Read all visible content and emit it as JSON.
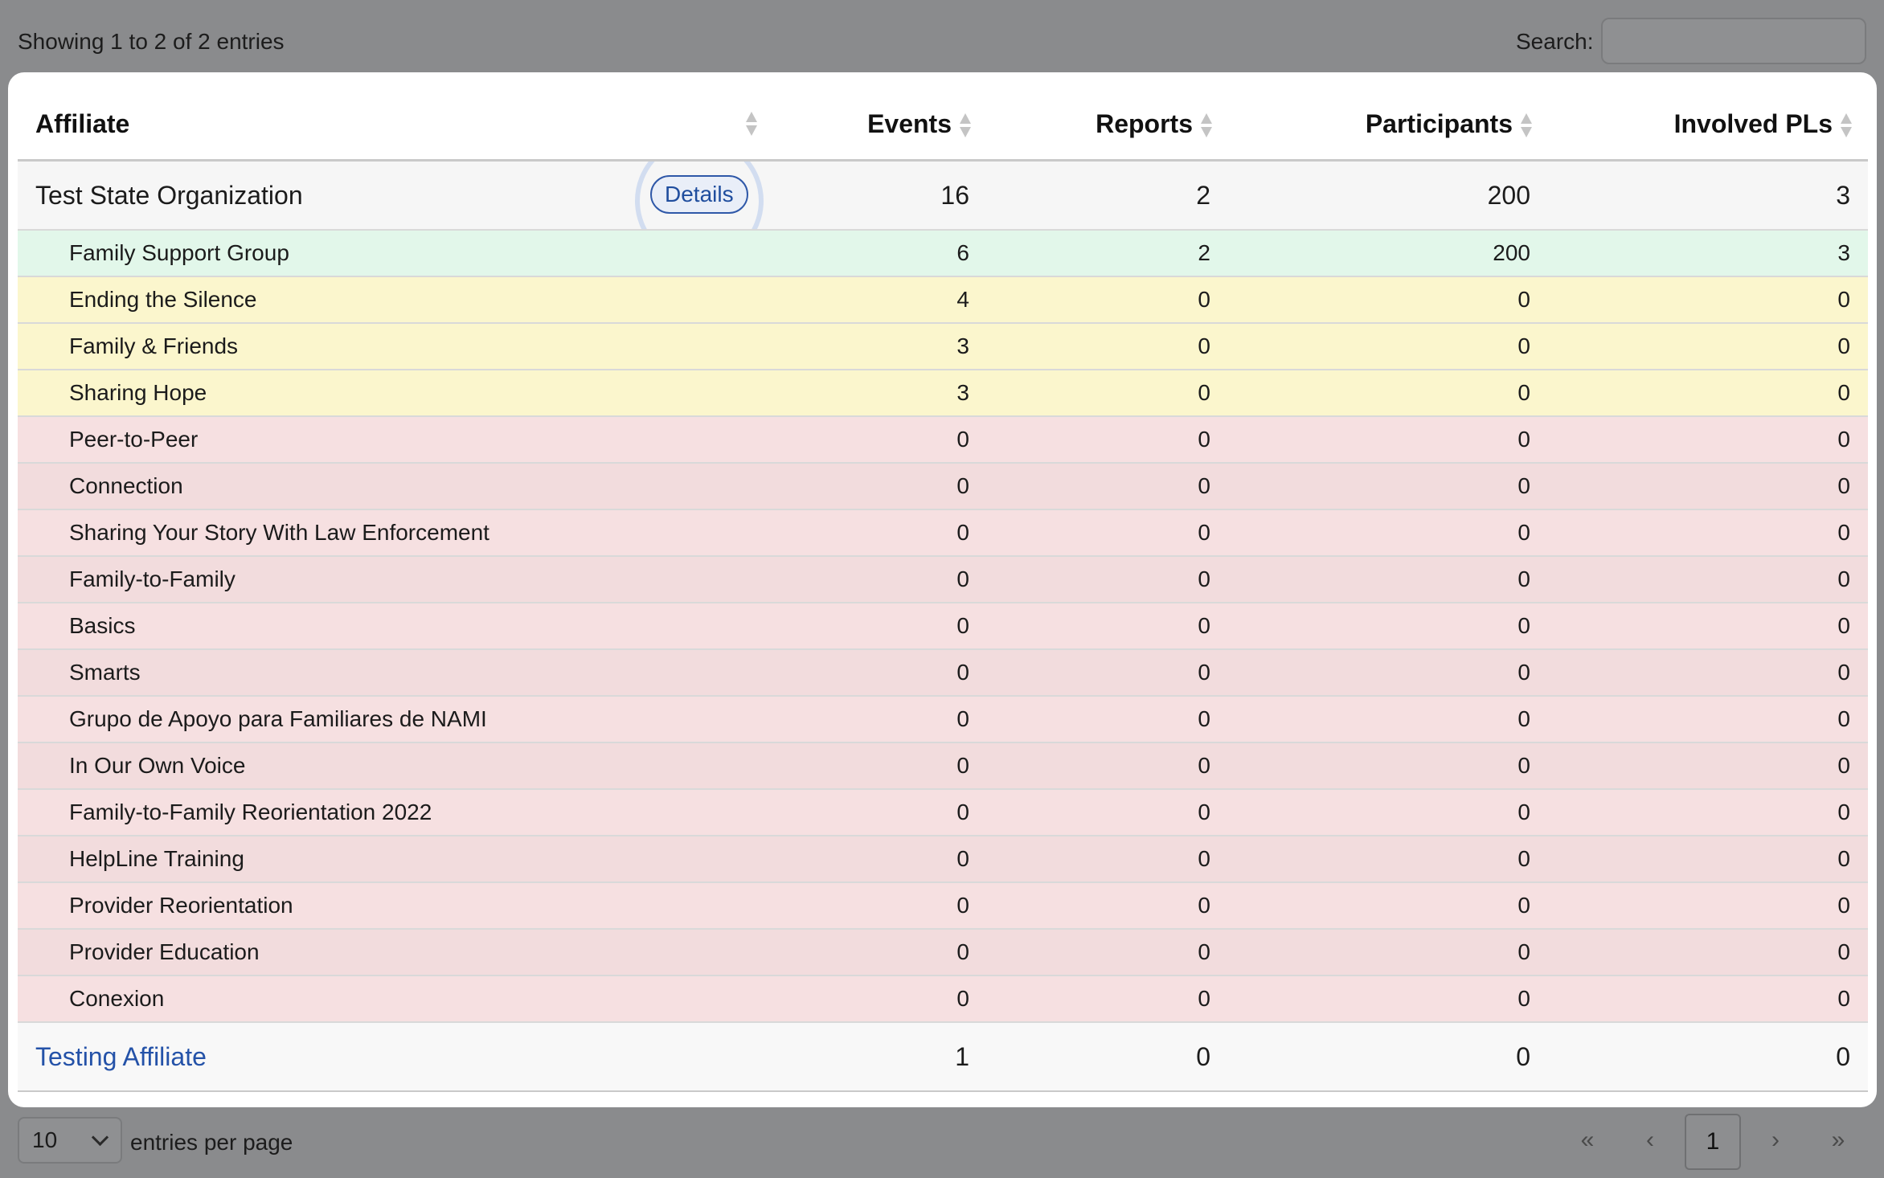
{
  "top": {
    "info": "Showing 1 to 2 of 2 entries",
    "search_label": "Search:",
    "search_value": ""
  },
  "table": {
    "headers": [
      "Affiliate",
      "Events",
      "Reports",
      "Participants",
      "Involved PLs"
    ],
    "details_label": "Details",
    "groups": [
      {
        "name": "Test State Organization",
        "events": "16",
        "reports": "2",
        "participants": "200",
        "pls": "3",
        "children": [
          {
            "name": "Family Support Group",
            "events": "6",
            "reports": "2",
            "participants": "200",
            "pls": "3",
            "status": "green"
          },
          {
            "name": "Ending the Silence",
            "events": "4",
            "reports": "0",
            "participants": "0",
            "pls": "0",
            "status": "yellow"
          },
          {
            "name": "Family & Friends",
            "events": "3",
            "reports": "0",
            "participants": "0",
            "pls": "0",
            "status": "yellow"
          },
          {
            "name": "Sharing Hope",
            "events": "3",
            "reports": "0",
            "participants": "0",
            "pls": "0",
            "status": "yellow"
          },
          {
            "name": "Peer-to-Peer",
            "events": "0",
            "reports": "0",
            "participants": "0",
            "pls": "0",
            "status": "red"
          },
          {
            "name": "Connection",
            "events": "0",
            "reports": "0",
            "participants": "0",
            "pls": "0",
            "status": "red"
          },
          {
            "name": "Sharing Your Story With Law Enforcement",
            "events": "0",
            "reports": "0",
            "participants": "0",
            "pls": "0",
            "status": "red"
          },
          {
            "name": "Family-to-Family",
            "events": "0",
            "reports": "0",
            "participants": "0",
            "pls": "0",
            "status": "red"
          },
          {
            "name": "Basics",
            "events": "0",
            "reports": "0",
            "participants": "0",
            "pls": "0",
            "status": "red"
          },
          {
            "name": "Smarts",
            "events": "0",
            "reports": "0",
            "participants": "0",
            "pls": "0",
            "status": "red"
          },
          {
            "name": "Grupo de Apoyo para Familiares de NAMI",
            "events": "0",
            "reports": "0",
            "participants": "0",
            "pls": "0",
            "status": "red"
          },
          {
            "name": "In Our Own Voice",
            "events": "0",
            "reports": "0",
            "participants": "0",
            "pls": "0",
            "status": "red"
          },
          {
            "name": "Family-to-Family Reorientation 2022",
            "events": "0",
            "reports": "0",
            "participants": "0",
            "pls": "0",
            "status": "red"
          },
          {
            "name": "HelpLine Training",
            "events": "0",
            "reports": "0",
            "participants": "0",
            "pls": "0",
            "status": "red"
          },
          {
            "name": "Provider Reorientation",
            "events": "0",
            "reports": "0",
            "participants": "0",
            "pls": "0",
            "status": "red"
          },
          {
            "name": "Provider Education",
            "events": "0",
            "reports": "0",
            "participants": "0",
            "pls": "0",
            "status": "red"
          },
          {
            "name": "Conexion",
            "events": "0",
            "reports": "0",
            "participants": "0",
            "pls": "0",
            "status": "red"
          }
        ]
      },
      {
        "name": "Testing Affiliate",
        "events": "1",
        "reports": "0",
        "participants": "0",
        "pls": "0",
        "is_link": true
      }
    ]
  },
  "bottom": {
    "per_page_value": "10",
    "per_page_label": "entries per page",
    "pager": {
      "first": "«",
      "prev": "‹",
      "current": "1",
      "next": "›",
      "last": "»"
    }
  },
  "colors": {
    "background": "#8a8b8d",
    "green_row": "#e2f7ea",
    "yellow_row": "#fbf6cd",
    "red_row": "#f6e0e1",
    "link": "#2452a8"
  }
}
